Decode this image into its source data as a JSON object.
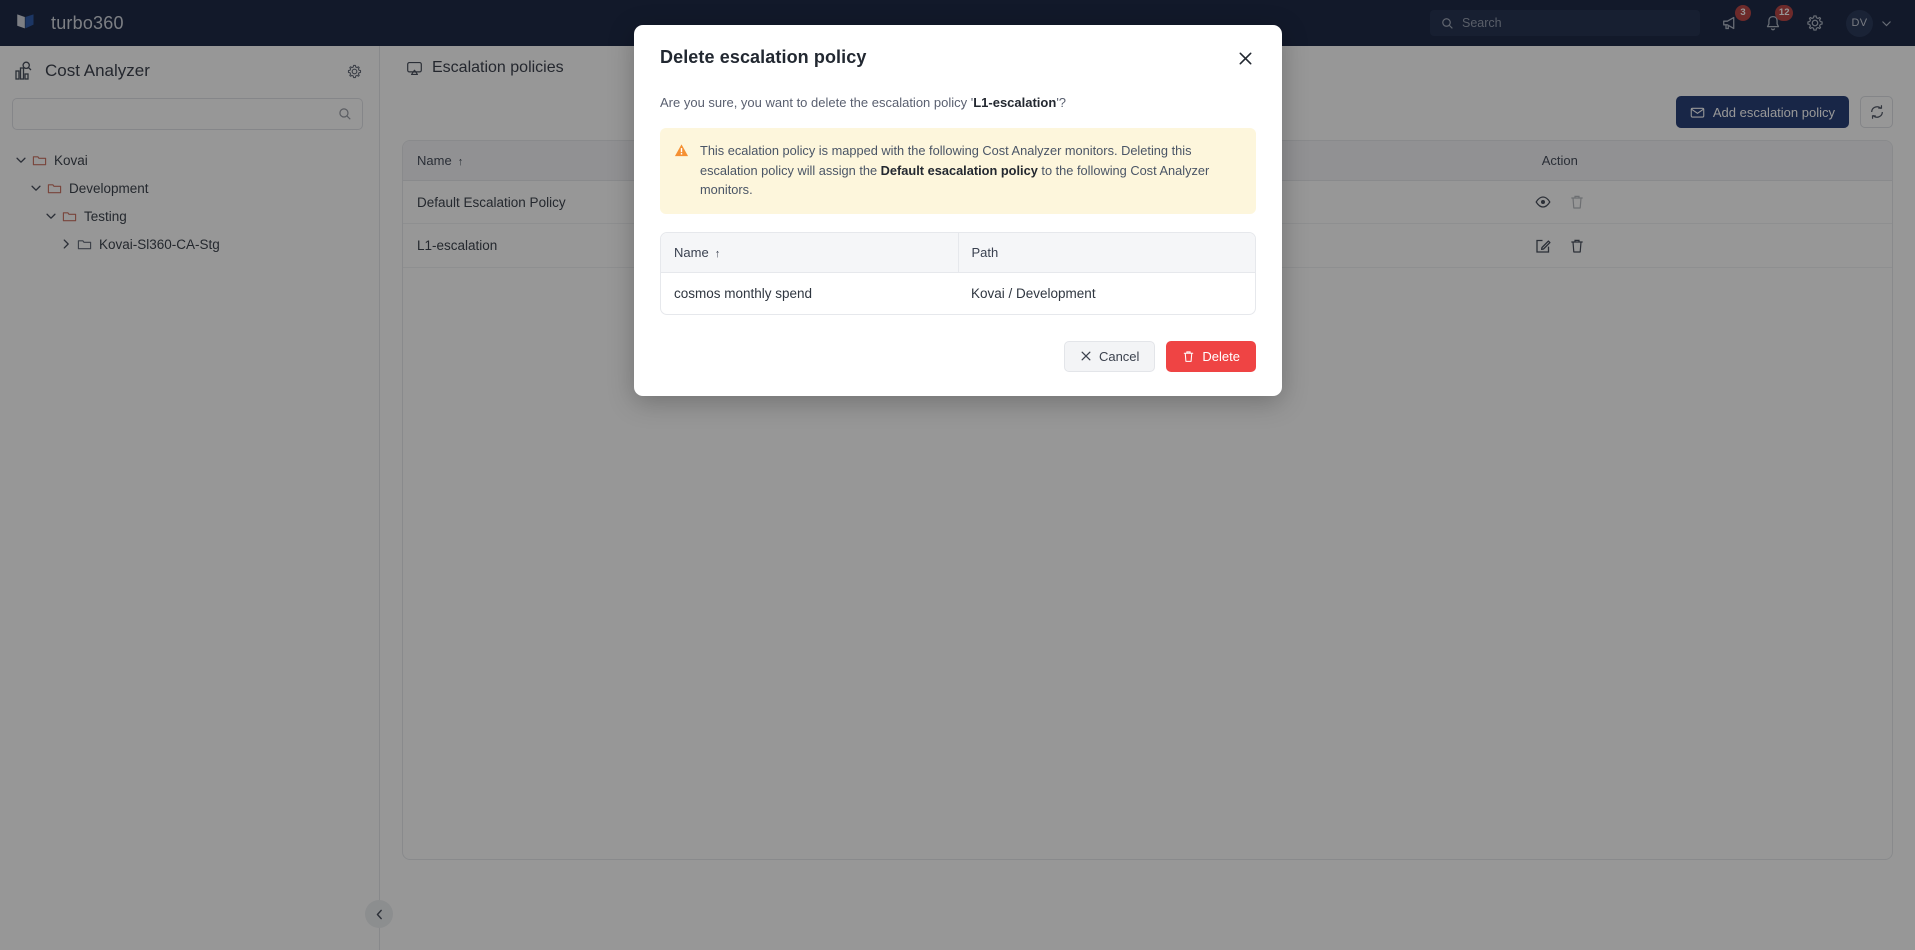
{
  "topnav": {
    "brand": "turbo360",
    "search_placeholder": "Search",
    "search_value": "",
    "announcements_badge": "3",
    "notifications_badge": "12",
    "avatar_initials": "DV"
  },
  "sidebar": {
    "title": "Cost Analyzer",
    "search_placeholder": "",
    "search_value": "",
    "tree": [
      {
        "label": "Kovai",
        "depth": 0,
        "expanded": true,
        "folder_color": "#c96a5a"
      },
      {
        "label": "Development",
        "depth": 1,
        "expanded": true,
        "folder_color": "#c96a5a"
      },
      {
        "label": "Testing",
        "depth": 2,
        "expanded": true,
        "folder_color": "#c96a5a"
      },
      {
        "label": "Kovai-Sl360-CA-Stg",
        "depth": 3,
        "expanded": false,
        "folder_color": "#5a6270"
      }
    ]
  },
  "main": {
    "title": "Escalation policies",
    "add_button": "Add escalation policy",
    "columns": {
      "name": "Name",
      "action": "Action",
      "sort_arrow": "↑"
    },
    "rows": [
      {
        "name": "Default Escalation Policy",
        "actions": [
          "view",
          "delete-disabled"
        ]
      },
      {
        "name": "L1-escalation",
        "actions": [
          "edit",
          "delete"
        ]
      }
    ]
  },
  "modal": {
    "title": "Delete escalation policy",
    "confirm_prefix": "Are you sure, you want to delete the escalation policy '",
    "confirm_policy": "L1-escalation",
    "confirm_suffix": "'?",
    "warning": {
      "part1": "This ecalation policy is mapped with the following Cost Analyzer monitors. Deleting this escalation policy will assign the ",
      "bold": "Default esacalation policy",
      "part2": " to the following Cost Analyzer monitors."
    },
    "table": {
      "columns": {
        "name": "Name",
        "path": "Path",
        "sort_arrow": "↑"
      },
      "rows": [
        {
          "name": "cosmos monthly spend",
          "path": "Kovai / Development"
        }
      ]
    },
    "cancel_label": "Cancel",
    "delete_label": "Delete"
  },
  "colors": {
    "navbar": "#0d1b39",
    "primary": "#18326e",
    "danger": "#ef4444",
    "warning_bg": "#fdf6dc",
    "warning_icon": "#f59032",
    "badge": "#b33a3a"
  }
}
